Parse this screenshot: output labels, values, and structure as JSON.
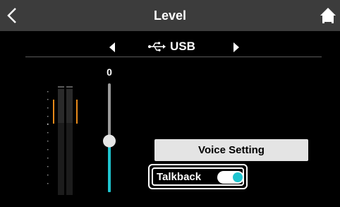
{
  "header": {
    "title": "Level",
    "back_icon": "chevron-left-icon",
    "home_icon": "home-icon"
  },
  "source": {
    "label": "USB",
    "icon": "usb-icon",
    "prev_icon": "triangle-left-icon",
    "next_icon": "triangle-right-icon"
  },
  "fader": {
    "value_label": "0",
    "level": 0.47,
    "accent_color": "#1fc4cf"
  },
  "meters": {
    "peak_color": "#e88a1a",
    "channels": 2
  },
  "buttons": {
    "voice_setting": "Voice Setting"
  },
  "talkback": {
    "label": "Talkback",
    "on": true,
    "toggle_color": "#1fc4cf"
  },
  "colors": {
    "header_bg": "#3c3c3c",
    "background": "#000000",
    "button_bg": "#e4e4e4"
  }
}
